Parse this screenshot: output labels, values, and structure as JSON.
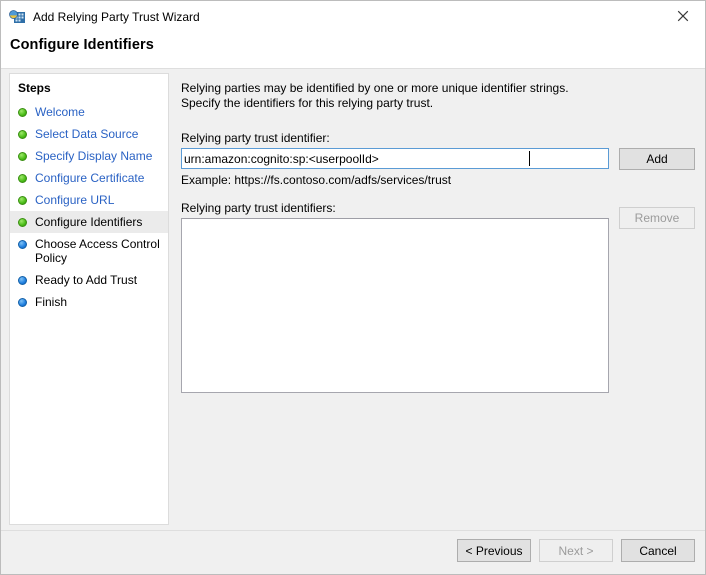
{
  "window": {
    "title": "Add Relying Party Trust Wizard",
    "icon": "wizard-app-icon",
    "close_icon": "close-icon",
    "page_title": "Configure Identifiers"
  },
  "sidebar": {
    "header": "Steps",
    "items": [
      {
        "label": "Welcome",
        "state": "done"
      },
      {
        "label": "Select Data Source",
        "state": "done"
      },
      {
        "label": "Specify Display Name",
        "state": "done"
      },
      {
        "label": "Configure Certificate",
        "state": "done"
      },
      {
        "label": "Configure URL",
        "state": "done"
      },
      {
        "label": "Configure Identifiers",
        "state": "current"
      },
      {
        "label": "Choose Access Control Policy",
        "state": "pending"
      },
      {
        "label": "Ready to Add Trust",
        "state": "pending"
      },
      {
        "label": "Finish",
        "state": "pending"
      }
    ]
  },
  "content": {
    "intro": "Relying parties may be identified by one or more unique identifier strings. Specify the identifiers for this relying party trust.",
    "identifier_label": "Relying party trust identifier:",
    "identifier_value": "urn:amazon:cognito:sp:<userpoolId>",
    "identifier_placeholder": "",
    "example_text": "Example: https://fs.contoso.com/adfs/services/trust",
    "identifiers_label": "Relying party trust identifiers:",
    "identifiers_list": [],
    "add_button": "Add",
    "remove_button": "Remove"
  },
  "footer": {
    "previous_button": "< Previous",
    "next_button": "Next >",
    "cancel_button": "Cancel"
  },
  "colors": {
    "step_link": "#2a62c4",
    "step_done_bullet": "#4bbd18",
    "step_pending_bullet": "#1f7fe0",
    "input_focus_border": "#5b9bd5",
    "body_background": "#f0f0f0",
    "panel_background": "#ffffff"
  }
}
